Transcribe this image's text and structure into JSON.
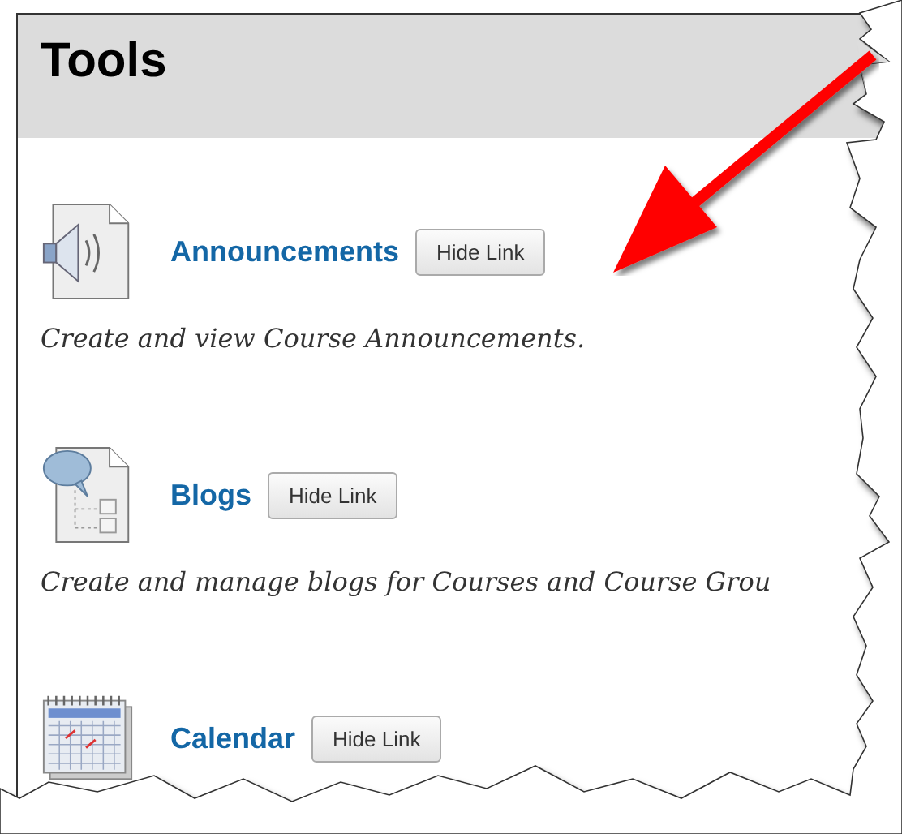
{
  "panel": {
    "title": "Tools"
  },
  "tools": [
    {
      "kind": "announcements",
      "name": "Announcements",
      "button": "Hide Link",
      "description": "Create and view Course Announcements."
    },
    {
      "kind": "blogs",
      "name": "Blogs",
      "button": "Hide Link",
      "description": "Create and manage blogs for Courses and Course Grou"
    },
    {
      "kind": "calendar",
      "name": "Calendar",
      "button": "Hide Link"
    }
  ]
}
